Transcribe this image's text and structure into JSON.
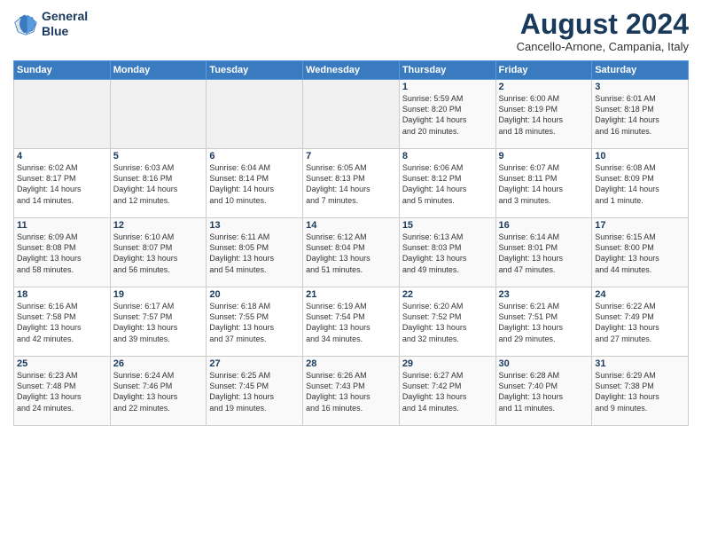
{
  "logo": {
    "line1": "General",
    "line2": "Blue"
  },
  "title": "August 2024",
  "location": "Cancello-Arnone, Campania, Italy",
  "days_of_week": [
    "Sunday",
    "Monday",
    "Tuesday",
    "Wednesday",
    "Thursday",
    "Friday",
    "Saturday"
  ],
  "weeks": [
    [
      {
        "day": "",
        "info": ""
      },
      {
        "day": "",
        "info": ""
      },
      {
        "day": "",
        "info": ""
      },
      {
        "day": "",
        "info": ""
      },
      {
        "day": "1",
        "info": "Sunrise: 5:59 AM\nSunset: 8:20 PM\nDaylight: 14 hours\nand 20 minutes."
      },
      {
        "day": "2",
        "info": "Sunrise: 6:00 AM\nSunset: 8:19 PM\nDaylight: 14 hours\nand 18 minutes."
      },
      {
        "day": "3",
        "info": "Sunrise: 6:01 AM\nSunset: 8:18 PM\nDaylight: 14 hours\nand 16 minutes."
      }
    ],
    [
      {
        "day": "4",
        "info": "Sunrise: 6:02 AM\nSunset: 8:17 PM\nDaylight: 14 hours\nand 14 minutes."
      },
      {
        "day": "5",
        "info": "Sunrise: 6:03 AM\nSunset: 8:16 PM\nDaylight: 14 hours\nand 12 minutes."
      },
      {
        "day": "6",
        "info": "Sunrise: 6:04 AM\nSunset: 8:14 PM\nDaylight: 14 hours\nand 10 minutes."
      },
      {
        "day": "7",
        "info": "Sunrise: 6:05 AM\nSunset: 8:13 PM\nDaylight: 14 hours\nand 7 minutes."
      },
      {
        "day": "8",
        "info": "Sunrise: 6:06 AM\nSunset: 8:12 PM\nDaylight: 14 hours\nand 5 minutes."
      },
      {
        "day": "9",
        "info": "Sunrise: 6:07 AM\nSunset: 8:11 PM\nDaylight: 14 hours\nand 3 minutes."
      },
      {
        "day": "10",
        "info": "Sunrise: 6:08 AM\nSunset: 8:09 PM\nDaylight: 14 hours\nand 1 minute."
      }
    ],
    [
      {
        "day": "11",
        "info": "Sunrise: 6:09 AM\nSunset: 8:08 PM\nDaylight: 13 hours\nand 58 minutes."
      },
      {
        "day": "12",
        "info": "Sunrise: 6:10 AM\nSunset: 8:07 PM\nDaylight: 13 hours\nand 56 minutes."
      },
      {
        "day": "13",
        "info": "Sunrise: 6:11 AM\nSunset: 8:05 PM\nDaylight: 13 hours\nand 54 minutes."
      },
      {
        "day": "14",
        "info": "Sunrise: 6:12 AM\nSunset: 8:04 PM\nDaylight: 13 hours\nand 51 minutes."
      },
      {
        "day": "15",
        "info": "Sunrise: 6:13 AM\nSunset: 8:03 PM\nDaylight: 13 hours\nand 49 minutes."
      },
      {
        "day": "16",
        "info": "Sunrise: 6:14 AM\nSunset: 8:01 PM\nDaylight: 13 hours\nand 47 minutes."
      },
      {
        "day": "17",
        "info": "Sunrise: 6:15 AM\nSunset: 8:00 PM\nDaylight: 13 hours\nand 44 minutes."
      }
    ],
    [
      {
        "day": "18",
        "info": "Sunrise: 6:16 AM\nSunset: 7:58 PM\nDaylight: 13 hours\nand 42 minutes."
      },
      {
        "day": "19",
        "info": "Sunrise: 6:17 AM\nSunset: 7:57 PM\nDaylight: 13 hours\nand 39 minutes."
      },
      {
        "day": "20",
        "info": "Sunrise: 6:18 AM\nSunset: 7:55 PM\nDaylight: 13 hours\nand 37 minutes."
      },
      {
        "day": "21",
        "info": "Sunrise: 6:19 AM\nSunset: 7:54 PM\nDaylight: 13 hours\nand 34 minutes."
      },
      {
        "day": "22",
        "info": "Sunrise: 6:20 AM\nSunset: 7:52 PM\nDaylight: 13 hours\nand 32 minutes."
      },
      {
        "day": "23",
        "info": "Sunrise: 6:21 AM\nSunset: 7:51 PM\nDaylight: 13 hours\nand 29 minutes."
      },
      {
        "day": "24",
        "info": "Sunrise: 6:22 AM\nSunset: 7:49 PM\nDaylight: 13 hours\nand 27 minutes."
      }
    ],
    [
      {
        "day": "25",
        "info": "Sunrise: 6:23 AM\nSunset: 7:48 PM\nDaylight: 13 hours\nand 24 minutes."
      },
      {
        "day": "26",
        "info": "Sunrise: 6:24 AM\nSunset: 7:46 PM\nDaylight: 13 hours\nand 22 minutes."
      },
      {
        "day": "27",
        "info": "Sunrise: 6:25 AM\nSunset: 7:45 PM\nDaylight: 13 hours\nand 19 minutes."
      },
      {
        "day": "28",
        "info": "Sunrise: 6:26 AM\nSunset: 7:43 PM\nDaylight: 13 hours\nand 16 minutes."
      },
      {
        "day": "29",
        "info": "Sunrise: 6:27 AM\nSunset: 7:42 PM\nDaylight: 13 hours\nand 14 minutes."
      },
      {
        "day": "30",
        "info": "Sunrise: 6:28 AM\nSunset: 7:40 PM\nDaylight: 13 hours\nand 11 minutes."
      },
      {
        "day": "31",
        "info": "Sunrise: 6:29 AM\nSunset: 7:38 PM\nDaylight: 13 hours\nand 9 minutes."
      }
    ]
  ]
}
